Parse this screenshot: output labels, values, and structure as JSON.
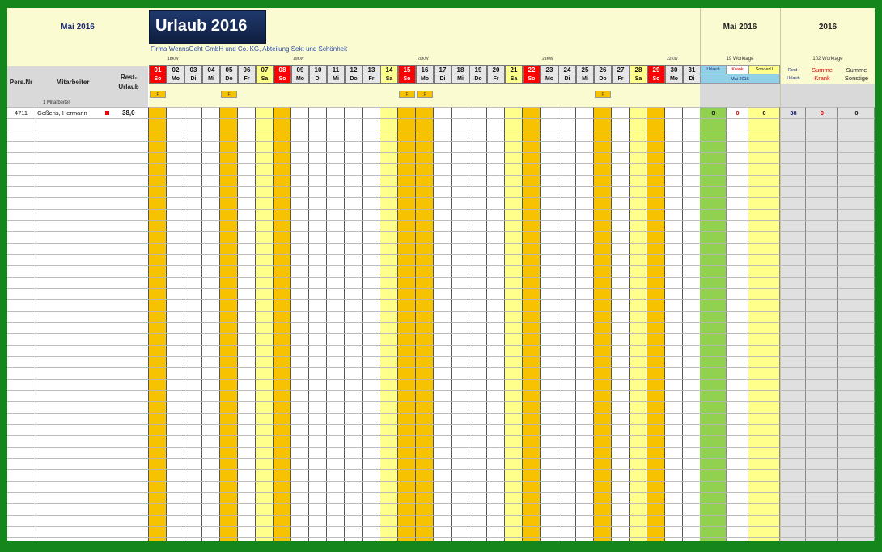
{
  "header": {
    "month_label": "Mai 2016",
    "title": "Urlaub 2016",
    "company": "Firma WennsGeht GmbH und Co. KG, Abteilung Sekt und Schönheit",
    "summary_month": {
      "label": "Mai 2016",
      "worktags": "19 Worktage",
      "col_labels": [
        "Urlaub",
        "Krank",
        "SonderU"
      ],
      "sub_label": "Mai 2016"
    },
    "summary_year": {
      "label": "2016",
      "worktags": "102 Worktage",
      "col_labels": [
        "Rest-Urlaub",
        "Summe Krank",
        "Summe Sonstige"
      ]
    }
  },
  "columns": {
    "pers_nr": "Pers.Nr",
    "mitarbeiter": "Mitarbeiter",
    "rest_urlaub": "Rest-Urlaub",
    "count": "1 Mitarbeiter"
  },
  "kw_labels": [
    "18KW",
    "19KW",
    "20KW",
    "21KW",
    "22KW"
  ],
  "days": [
    {
      "num": "01",
      "wd": "So",
      "type": "sun"
    },
    {
      "num": "02",
      "wd": "Mo",
      "type": "work"
    },
    {
      "num": "03",
      "wd": "Di",
      "type": "work"
    },
    {
      "num": "04",
      "wd": "Mi",
      "type": "work"
    },
    {
      "num": "05",
      "wd": "Do",
      "type": "hol"
    },
    {
      "num": "06",
      "wd": "Fr",
      "type": "work"
    },
    {
      "num": "07",
      "wd": "Sa",
      "type": "sat"
    },
    {
      "num": "08",
      "wd": "So",
      "type": "sun"
    },
    {
      "num": "09",
      "wd": "Mo",
      "type": "work"
    },
    {
      "num": "10",
      "wd": "Di",
      "type": "work"
    },
    {
      "num": "11",
      "wd": "Mi",
      "type": "work"
    },
    {
      "num": "12",
      "wd": "Do",
      "type": "work"
    },
    {
      "num": "13",
      "wd": "Fr",
      "type": "work"
    },
    {
      "num": "14",
      "wd": "Sa",
      "type": "sat"
    },
    {
      "num": "15",
      "wd": "So",
      "type": "sun"
    },
    {
      "num": "16",
      "wd": "Mo",
      "type": "hol"
    },
    {
      "num": "17",
      "wd": "Di",
      "type": "work"
    },
    {
      "num": "18",
      "wd": "Mi",
      "type": "work"
    },
    {
      "num": "19",
      "wd": "Do",
      "type": "work"
    },
    {
      "num": "20",
      "wd": "Fr",
      "type": "work"
    },
    {
      "num": "21",
      "wd": "Sa",
      "type": "sat"
    },
    {
      "num": "22",
      "wd": "So",
      "type": "sun"
    },
    {
      "num": "23",
      "wd": "Mo",
      "type": "work"
    },
    {
      "num": "24",
      "wd": "Di",
      "type": "work"
    },
    {
      "num": "25",
      "wd": "Mi",
      "type": "work"
    },
    {
      "num": "26",
      "wd": "Do",
      "type": "hol"
    },
    {
      "num": "27",
      "wd": "Fr",
      "type": "work"
    },
    {
      "num": "28",
      "wd": "Sa",
      "type": "sat"
    },
    {
      "num": "29",
      "wd": "So",
      "type": "sun"
    },
    {
      "num": "30",
      "wd": "Mo",
      "type": "work"
    },
    {
      "num": "31",
      "wd": "Di",
      "type": "work"
    }
  ],
  "holiday_marker": "F",
  "employees": [
    {
      "pers_nr": "4711",
      "name": "Goßens, Hermann",
      "rest": "38,0",
      "urlaub": "0",
      "krank": "0",
      "sonder": "0",
      "rest_year": "38",
      "krank_year": "0",
      "sonstige_year": "0"
    }
  ],
  "colors": {
    "sunday_red": "#ff0000",
    "holiday_orange": "#f7c200",
    "saturday_yellow": "#ffff8c",
    "header_cream": "#fbfbd2",
    "urlaub_green": "#92d050",
    "title_navy": "#1a2d57",
    "frame_green": "#15861c"
  }
}
